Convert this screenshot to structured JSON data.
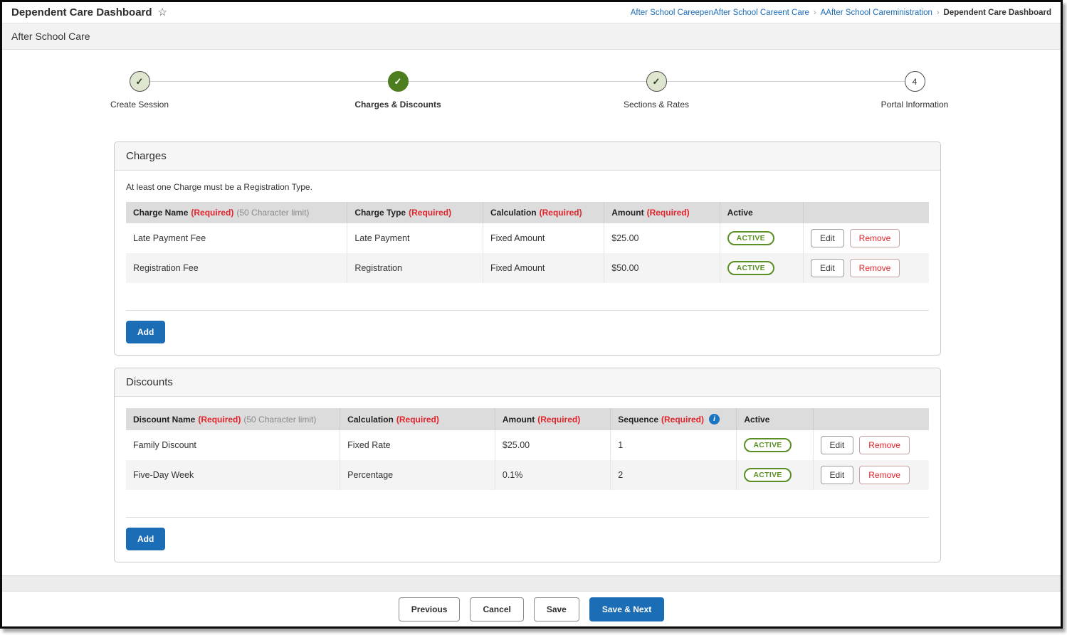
{
  "icons": {
    "star": "☆",
    "check": "✓",
    "info": "i",
    "breadcrumb_separator": "›"
  },
  "title_bar": {
    "title": "Dependent Care Dashboard"
  },
  "breadcrumb": {
    "items": [
      {
        "label": "After School CareepenAfter School Careent Care"
      },
      {
        "label": "AAfter School Careministration"
      },
      {
        "label": "Dependent Care Dashboard"
      }
    ]
  },
  "context_bar": {
    "title": "After School Care"
  },
  "stepper": {
    "steps": [
      {
        "label": "Create Session",
        "state": "completed"
      },
      {
        "label": "Charges & Discounts",
        "state": "active"
      },
      {
        "label": "Sections & Rates",
        "state": "completed"
      },
      {
        "label": "Portal Information",
        "state": "upcoming",
        "number": "4"
      }
    ]
  },
  "charges": {
    "card_title": "Charges",
    "note": "At least one Charge must be a Registration Type.",
    "columns": [
      {
        "label": "Charge Name",
        "required": "(Required)",
        "hint": "(50 Character limit)"
      },
      {
        "label": "Charge Type",
        "required": "(Required)"
      },
      {
        "label": "Calculation",
        "required": "(Required)"
      },
      {
        "label": "Amount",
        "required": "(Required)"
      },
      {
        "label": "Active"
      },
      {
        "label": ""
      }
    ],
    "rows": [
      {
        "name": "Late Payment Fee",
        "type": "Late Payment",
        "calculation": "Fixed Amount",
        "amount": "$25.00",
        "active": "ACTIVE"
      },
      {
        "name": "Registration Fee",
        "type": "Registration",
        "calculation": "Fixed Amount",
        "amount": "$50.00",
        "active": "ACTIVE"
      }
    ],
    "actions": {
      "edit": "Edit",
      "remove": "Remove"
    },
    "add_label": "Add"
  },
  "discounts": {
    "card_title": "Discounts",
    "columns": [
      {
        "label": "Discount Name",
        "required": "(Required)",
        "hint": "(50 Character limit)"
      },
      {
        "label": "Calculation",
        "required": "(Required)"
      },
      {
        "label": "Amount",
        "required": "(Required)"
      },
      {
        "label": "Sequence",
        "required": "(Required)"
      },
      {
        "label": "Active"
      },
      {
        "label": ""
      }
    ],
    "rows": [
      {
        "name": "Family Discount",
        "calculation": "Fixed Rate",
        "amount": "$25.00",
        "sequence": "1",
        "active": "ACTIVE"
      },
      {
        "name": "Five-Day Week",
        "calculation": "Percentage",
        "amount": "0.1%",
        "sequence": "2",
        "active": "ACTIVE"
      }
    ],
    "actions": {
      "edit": "Edit",
      "remove": "Remove"
    },
    "add_label": "Add"
  },
  "footer": {
    "previous": "Previous",
    "cancel": "Cancel",
    "save": "Save",
    "save_next": "Save & Next"
  },
  "colors": {
    "accent_blue": "#1b6db6",
    "link_blue": "#1b6cb5",
    "required_red": "#e0242b",
    "active_step_green": "#4e7d1f",
    "completed_step_fill": "#dfe6cf",
    "badge_green": "#5a8f23",
    "header_gray": "#dcdcdc",
    "alt_row_gray": "#f4f4f4"
  }
}
